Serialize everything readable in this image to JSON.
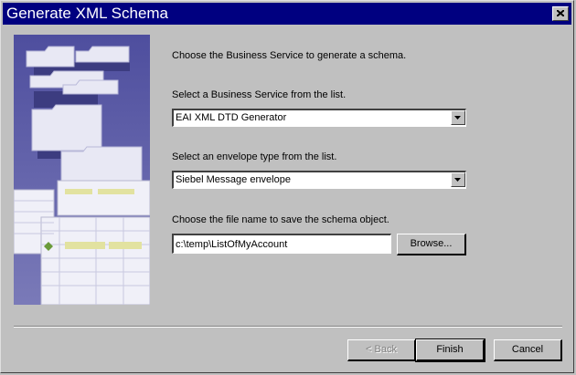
{
  "window": {
    "title": "Generate XML Schema"
  },
  "instructions": {
    "intro": "Choose the Business Service to generate a schema.",
    "service_label": "Select a Business Service from the list.",
    "envelope_label": "Select an envelope type from the list.",
    "file_label": "Choose the file name to save the schema object."
  },
  "fields": {
    "business_service": "EAI XML DTD  Generator",
    "envelope_type": "Siebel Message envelope",
    "file_name": "c:\\temp\\ListOfMyAccount"
  },
  "buttons": {
    "browse": "Browse...",
    "back": "< Back",
    "finish": "Finish",
    "cancel": "Cancel"
  },
  "icons": {
    "close": "close-icon",
    "dropdown": "chevron-down-icon"
  }
}
